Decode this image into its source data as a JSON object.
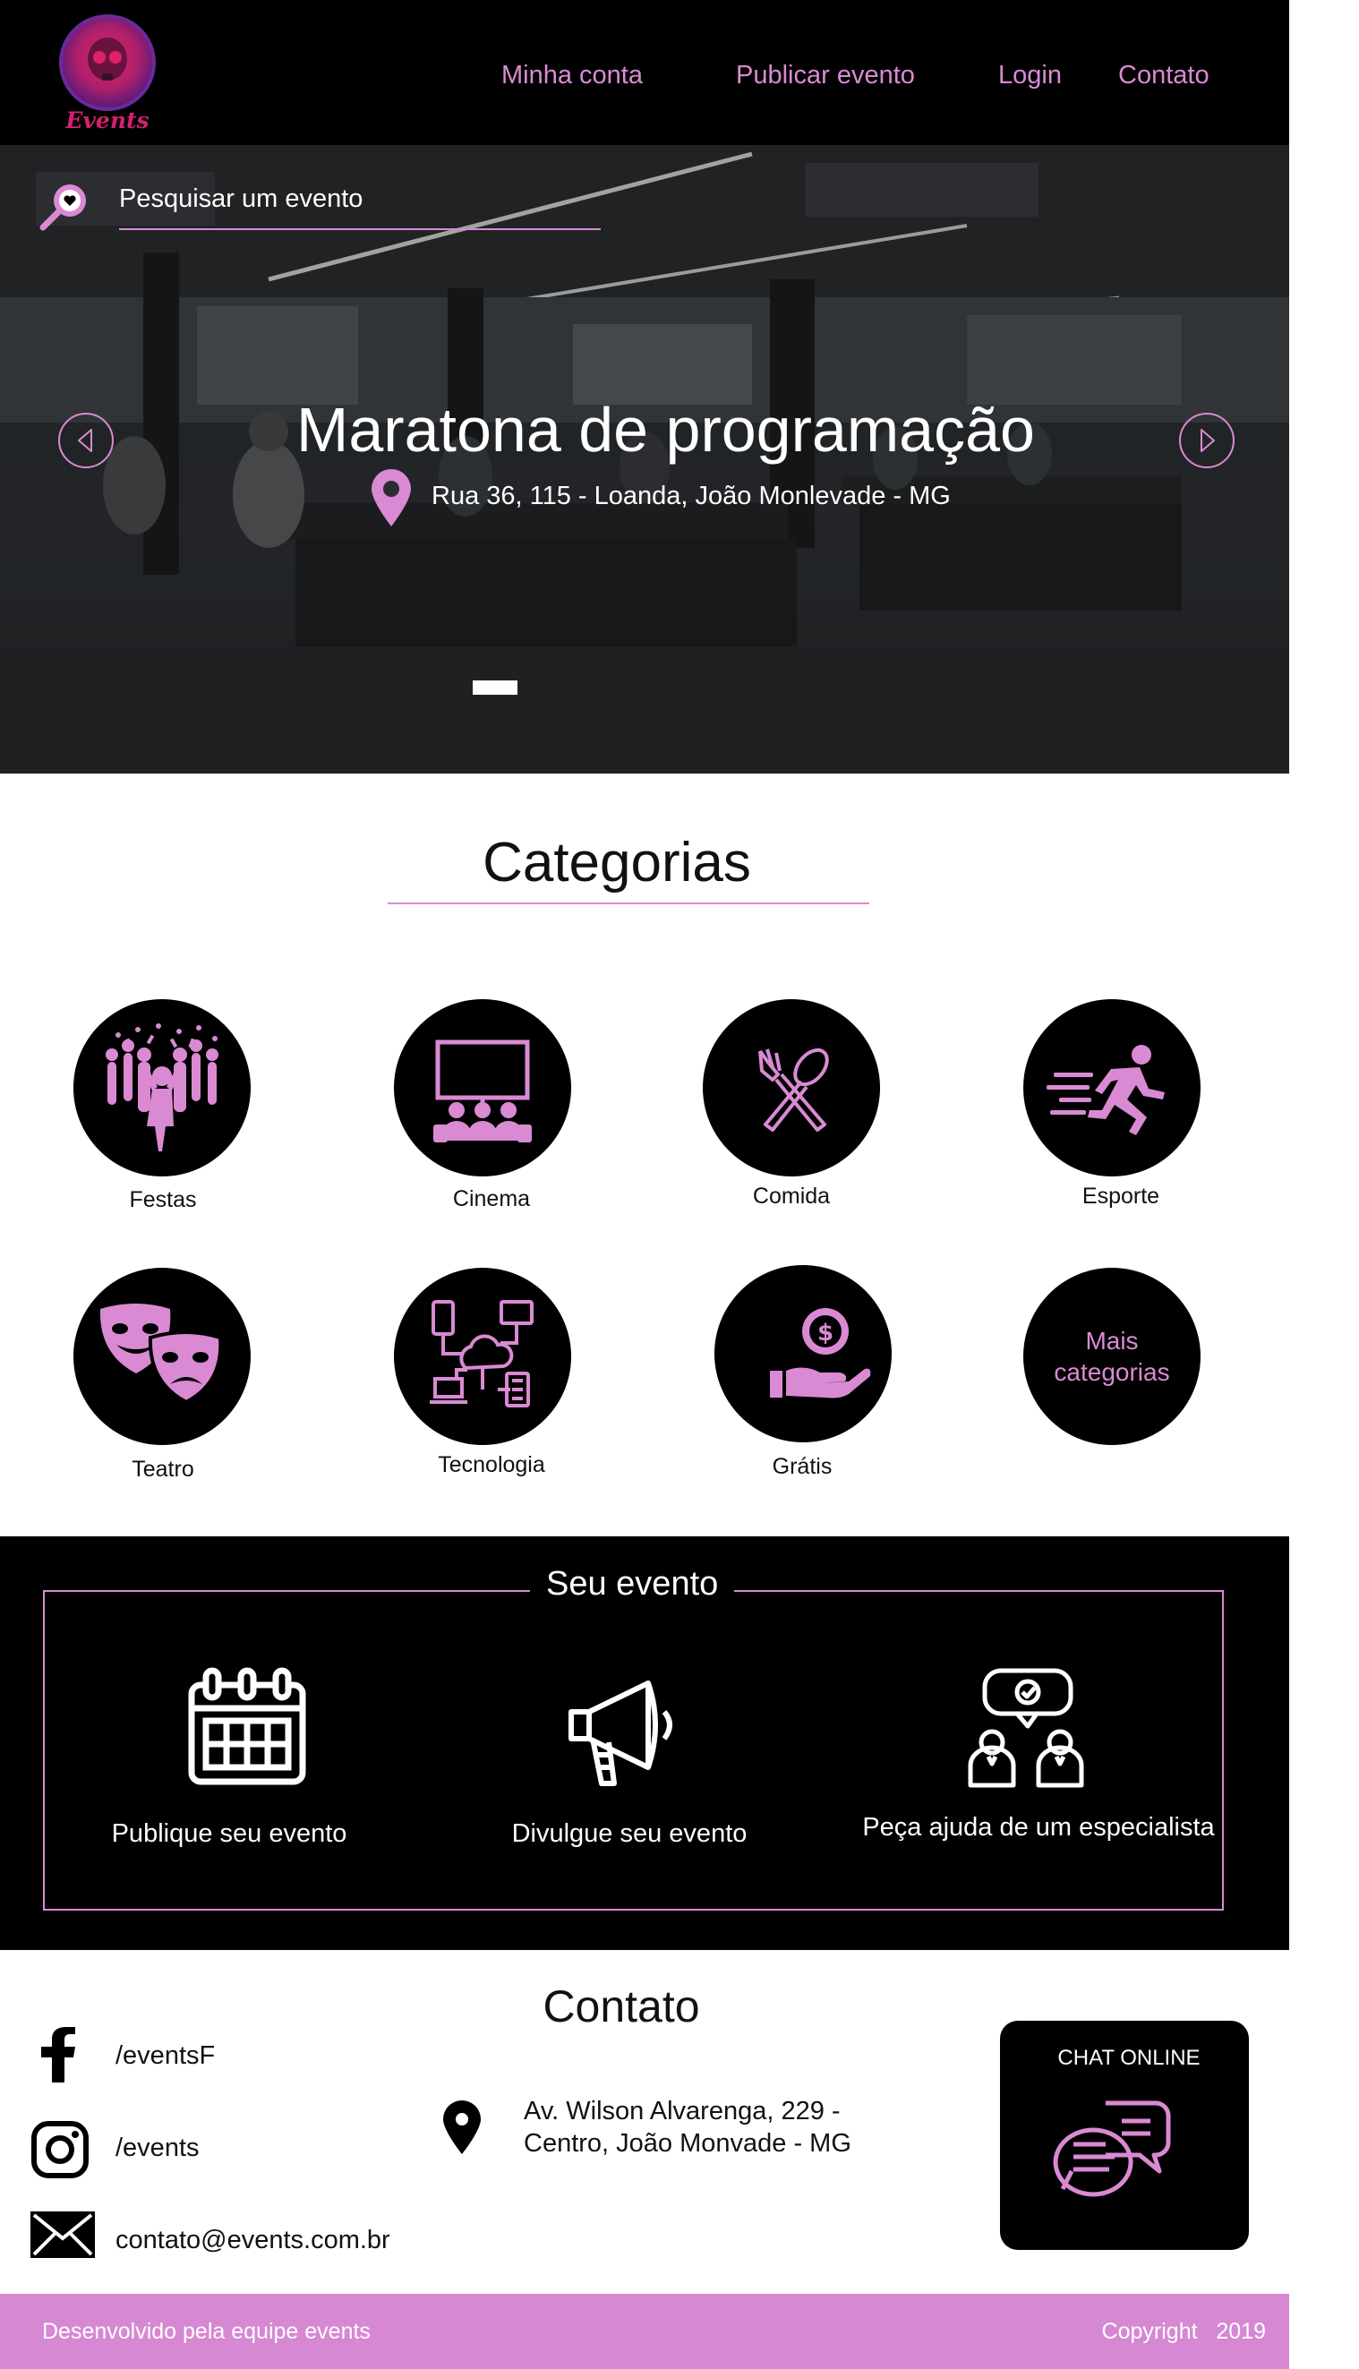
{
  "brand": {
    "logo_text": "Events",
    "accent": "#d98ad3",
    "footer_color": "#d688d2"
  },
  "nav": {
    "items": [
      {
        "label": "Minha conta"
      },
      {
        "label": "Publicar evento"
      },
      {
        "label": "Login"
      },
      {
        "label": "Contato"
      }
    ]
  },
  "search": {
    "placeholder": "Pesquisar um evento",
    "icon": "heart-magnifier-icon"
  },
  "hero": {
    "title": "Maratona de programação",
    "address": "Rua 36, 115 - Loanda, João Monlevade - MG",
    "slide_count": 1,
    "active_slide": 1
  },
  "categories": {
    "title": "Categorias",
    "items": [
      {
        "label": "Festas",
        "icon": "party-crowd-icon"
      },
      {
        "label": "Cinema",
        "icon": "cinema-audience-icon"
      },
      {
        "label": "Comida",
        "icon": "fork-spoon-icon"
      },
      {
        "label": "Esporte",
        "icon": "running-person-icon"
      },
      {
        "label": "Teatro",
        "icon": "theater-masks-icon"
      },
      {
        "label": "Tecnologia",
        "icon": "network-cloud-icon"
      },
      {
        "label": "Grátis",
        "icon": "hand-coin-icon"
      },
      {
        "label": "Mais categorias",
        "icon": ""
      }
    ]
  },
  "your_event": {
    "title": "Seu evento",
    "items": [
      {
        "label": "Publique seu evento",
        "icon": "calendar-icon"
      },
      {
        "label": "Divulgue seu evento",
        "icon": "megaphone-icon"
      },
      {
        "label": "Peça ajuda de um especialista",
        "icon": "consultation-icon"
      }
    ]
  },
  "contact": {
    "title": "Contato",
    "facebook": "/eventsF",
    "instagram": "/events",
    "email": "contato@events.com.br",
    "address_line1": "Av. Wilson Alvarenga, 229 -",
    "address_line2": "Centro, João Monvade - MG",
    "chat_label": "CHAT ONLINE"
  },
  "footer": {
    "left": "Desenvolvido pela equipe events",
    "right": "Copyright   2019"
  }
}
